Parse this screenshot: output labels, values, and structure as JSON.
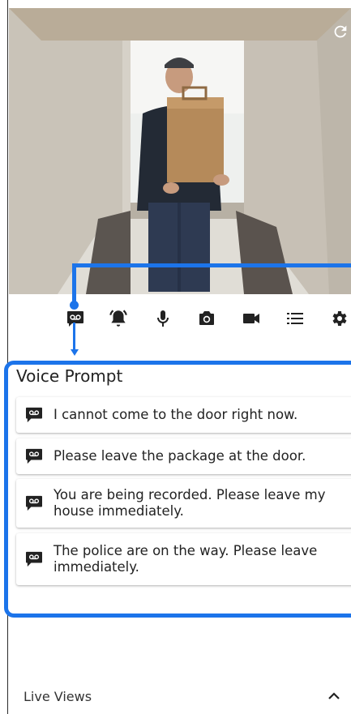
{
  "toolbar": {
    "icons": [
      "voicemail-icon",
      "alarm-bell-icon",
      "microphone-icon",
      "camera-icon",
      "video-icon",
      "list-icon",
      "gear-icon"
    ]
  },
  "voice_prompt": {
    "title": "Voice Prompt",
    "items": [
      "I cannot come to the door right now.",
      "Please leave the package at the door.",
      "You are being recorded. Please leave my house immediately.",
      "The police are on the way. Please leave immediately."
    ]
  },
  "footer": {
    "live_views_label": "Live Views"
  },
  "colors": {
    "highlight": "#1c74ea",
    "icon": "#222222",
    "text": "#222222"
  }
}
